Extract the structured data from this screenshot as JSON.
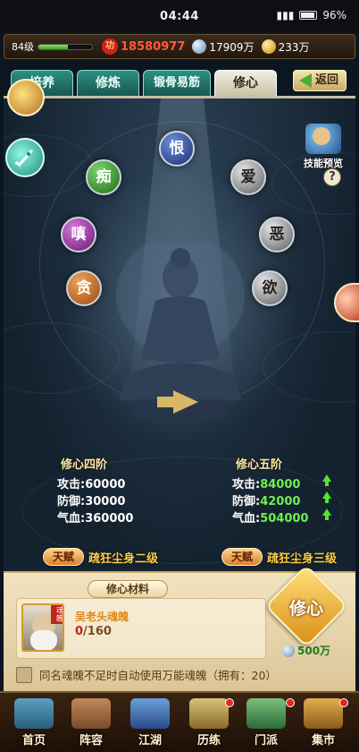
{
  "statusbar": {
    "time": "04:44",
    "battery": "96%"
  },
  "resources": {
    "level": "84级",
    "exp_fraction": 0.55,
    "power_icon": "功",
    "power": "18580977",
    "silver": "17909万",
    "gold": "233万"
  },
  "tabs": [
    {
      "label": "培养",
      "active": false
    },
    {
      "label": "修炼",
      "active": false
    },
    {
      "label": "锻骨易筋",
      "active": false
    },
    {
      "label": "修心",
      "active": true
    }
  ],
  "back_label": "返回",
  "skill_preview_label": "技能预览",
  "help_label": "?",
  "orbs": {
    "hen": "恨",
    "chi": "痴",
    "ai": "爱",
    "chen": "嗔",
    "e": "恶",
    "tan": "贪",
    "yu": "欲"
  },
  "current": {
    "title": "修心四阶",
    "atk_label": "攻击:",
    "atk": "60000",
    "def_label": "防御:",
    "def": "30000",
    "hp_label": "气血:",
    "hp": "360000"
  },
  "next": {
    "title": "修心五阶",
    "atk_label": "攻击:",
    "atk": "84000",
    "def_label": "防御:",
    "def": "42000",
    "hp_label": "气血:",
    "hp": "504000"
  },
  "talent_badge": "天赋",
  "talent_current": "疏狂尘身二级",
  "talent_next": "疏狂尘身三级",
  "material": {
    "title": "修心材料",
    "hun_tag": "魂魄",
    "name": "吴老头魂魄",
    "have": "0",
    "slash": "/",
    "need": "160",
    "refine_label": "修心",
    "cost": "500万",
    "auto_text": "同名魂魄不足时自动使用万能魂魄（拥有：20）"
  },
  "nav": [
    {
      "label": "首页"
    },
    {
      "label": "阵容"
    },
    {
      "label": "江湖"
    },
    {
      "label": "历练"
    },
    {
      "label": "门派"
    },
    {
      "label": "集市"
    }
  ]
}
